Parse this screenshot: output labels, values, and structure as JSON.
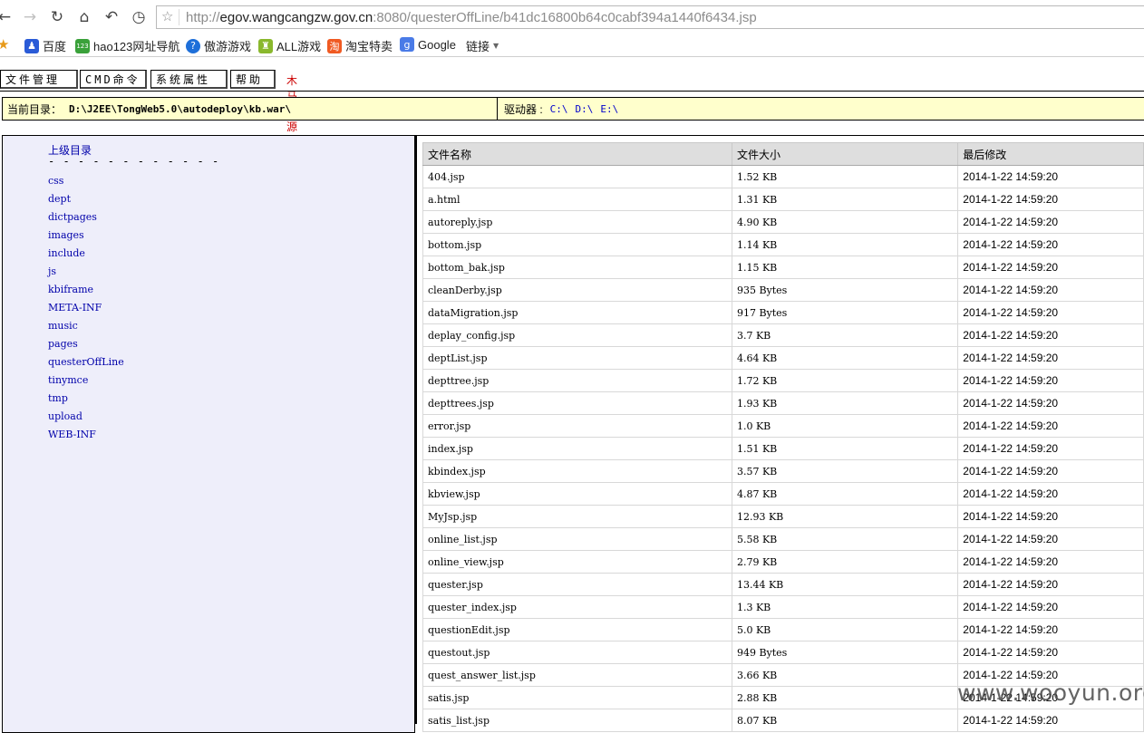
{
  "browser": {
    "url_host": "egov.wangcangzw.gov.cn",
    "url_prefix": "http://",
    "url_rest": ":8080/questerOffLine/b41dc16800b64c0cabf394a1440f6434.jsp",
    "bookmarks": [
      {
        "label": "百度",
        "icon": "paw-icon",
        "color": "#2a5bd7"
      },
      {
        "label": "hao123网址导航",
        "icon": "hao123-icon",
        "color": "#3aa13a"
      },
      {
        "label": "傲游游戏",
        "icon": "question-circle-icon",
        "color": "#1e6fd9"
      },
      {
        "label": "ALL游戏",
        "icon": "game-icon",
        "color": "#8ab82d"
      },
      {
        "label": "淘宝特卖",
        "icon": "taobao-icon",
        "color": "#f05a22"
      },
      {
        "label": "Google",
        "icon": "google-icon",
        "color": "#4a7be7"
      },
      {
        "label": "链接",
        "icon": "chevron-down-icon",
        "color": "#666666"
      }
    ]
  },
  "menu": {
    "file_mgmt": "文件管理",
    "cmd": "CMD命令",
    "sys_props": "系统属性",
    "help": "帮助",
    "brand": "木马资源网-专用版"
  },
  "dirbar": {
    "label": "当前目录：",
    "path": "D:\\J2EE\\TongWeb5.0\\autodeploy\\kb.war\\",
    "drives_label": "驱动器 :",
    "drives": [
      "C:\\",
      "D:\\",
      "E:\\"
    ]
  },
  "left": {
    "up_dir": "上级目录",
    "dashes": "- - - - - - - - - - - -",
    "folders": [
      "css",
      "dept",
      "dictpages",
      "images",
      "include",
      "js",
      "kbiframe",
      "META-INF",
      "music",
      "pages",
      "questerOffLine",
      "tinymce",
      "tmp",
      "upload",
      "WEB-INF"
    ]
  },
  "table": {
    "headers": [
      "文件名称",
      "文件大小",
      "最后修改"
    ],
    "rows": [
      [
        "404.jsp",
        "1.52 KB",
        "2014-1-22 14:59:20"
      ],
      [
        "a.html",
        "1.31 KB",
        "2014-1-22 14:59:20"
      ],
      [
        "autoreply.jsp",
        "4.90 KB",
        "2014-1-22 14:59:20"
      ],
      [
        "bottom.jsp",
        "1.14 KB",
        "2014-1-22 14:59:20"
      ],
      [
        "bottom_bak.jsp",
        "1.15 KB",
        "2014-1-22 14:59:20"
      ],
      [
        "cleanDerby.jsp",
        "935 Bytes",
        "2014-1-22 14:59:20"
      ],
      [
        "dataMigration.jsp",
        "917 Bytes",
        "2014-1-22 14:59:20"
      ],
      [
        "deplay_config.jsp",
        "3.7 KB",
        "2014-1-22 14:59:20"
      ],
      [
        "deptList.jsp",
        "4.64 KB",
        "2014-1-22 14:59:20"
      ],
      [
        "depttree.jsp",
        "1.72 KB",
        "2014-1-22 14:59:20"
      ],
      [
        "depttrees.jsp",
        "1.93 KB",
        "2014-1-22 14:59:20"
      ],
      [
        "error.jsp",
        "1.0 KB",
        "2014-1-22 14:59:20"
      ],
      [
        "index.jsp",
        "1.51 KB",
        "2014-1-22 14:59:20"
      ],
      [
        "kbindex.jsp",
        "3.57 KB",
        "2014-1-22 14:59:20"
      ],
      [
        "kbview.jsp",
        "4.87 KB",
        "2014-1-22 14:59:20"
      ],
      [
        "MyJsp.jsp",
        "12.93 KB",
        "2014-1-22 14:59:20"
      ],
      [
        "online_list.jsp",
        "5.58 KB",
        "2014-1-22 14:59:20"
      ],
      [
        "online_view.jsp",
        "2.79 KB",
        "2014-1-22 14:59:20"
      ],
      [
        "quester.jsp",
        "13.44 KB",
        "2014-1-22 14:59:20"
      ],
      [
        "quester_index.jsp",
        "1.3 KB",
        "2014-1-22 14:59:20"
      ],
      [
        "questionEdit.jsp",
        "5.0 KB",
        "2014-1-22 14:59:20"
      ],
      [
        "questout.jsp",
        "949 Bytes",
        "2014-1-22 14:59:20"
      ],
      [
        "quest_answer_list.jsp",
        "3.66 KB",
        "2014-1-22 14:59:20"
      ],
      [
        "satis.jsp",
        "2.88 KB",
        "2014-1-22 14:59:20"
      ],
      [
        "satis_list.jsp",
        "8.07 KB",
        "2014-1-22 14:59:20"
      ]
    ]
  },
  "watermark": "www.wooyun.org"
}
